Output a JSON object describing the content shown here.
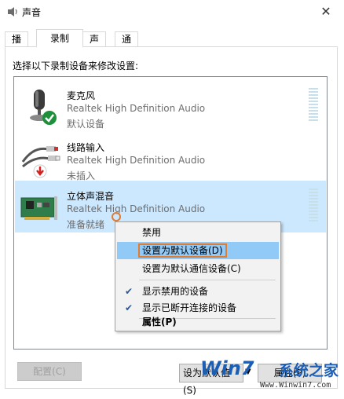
{
  "window": {
    "title": "声音",
    "close_glyph": "✕"
  },
  "tabs": [
    {
      "label": "播放"
    },
    {
      "label": "录制"
    },
    {
      "label": "声音"
    },
    {
      "label": "通信"
    }
  ],
  "active_tab": "录制",
  "instruction": "选择以下录制设备来修改设置:",
  "devices": [
    {
      "name": "麦克风",
      "driver": "Realtek High Definition Audio",
      "status": "默认设备",
      "icon": "microphone-icon",
      "badge": "green-check-icon"
    },
    {
      "name": "线路输入",
      "driver": "Realtek High Definition Audio",
      "status": "未插入",
      "icon": "line-in-cable-icon",
      "badge": "red-down-arrow-icon"
    },
    {
      "name": "立体声混音",
      "driver": "Realtek High Definition Audio",
      "status": "准备就绪",
      "icon": "sound-card-icon",
      "selected": true
    }
  ],
  "context_menu": {
    "items": [
      {
        "label": "禁用"
      },
      {
        "label": "设置为默认设备(D)",
        "highlighted": true
      },
      {
        "label": "设置为默认通信设备(C)"
      },
      {
        "label": "显示禁用的设备",
        "checked": true
      },
      {
        "label": "显示已断开连接的设备",
        "checked": true
      },
      {
        "label": "属性(P)",
        "bold": true
      }
    ],
    "check_glyph": "✔"
  },
  "buttons": {
    "configure": "配置(C)",
    "set_default": "设为默认值(S)",
    "dropdown_glyph": "▼",
    "properties": "属性(P)"
  },
  "watermark": {
    "logo": "Win7",
    "cn": "系统之家",
    "url": "Www.Winwin7.com"
  },
  "colors": {
    "selected_row": "#cce8ff",
    "menu_highlight": "#91c9f7",
    "highlight_border": "#e07b32",
    "status_green": "#1e8f3a",
    "status_red": "#d32020"
  }
}
